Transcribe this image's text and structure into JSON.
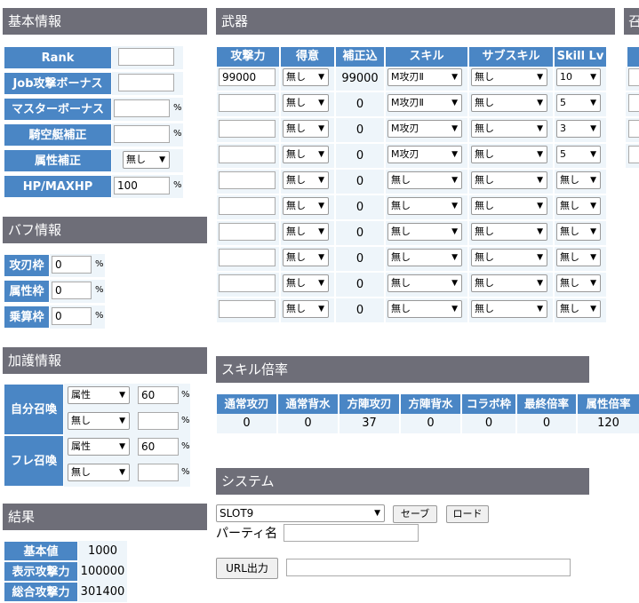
{
  "basic": {
    "title": "基本情報",
    "rank": "Rank",
    "job": "Job攻撃ボーナス",
    "master": "マスターボーナス",
    "sky": "騎空艇補正",
    "attr": "属性補正",
    "attr_value": "無し",
    "hp": "HP/MAXHP",
    "hp_value": "100",
    "pct": "%"
  },
  "buff": {
    "title": "バフ情報",
    "rows": [
      {
        "label": "攻刃枠",
        "value": "0"
      },
      {
        "label": "属性枠",
        "value": "0"
      },
      {
        "label": "乗算枠",
        "value": "0"
      }
    ]
  },
  "blessing": {
    "title": "加護情報",
    "self": "自分召喚",
    "friend": "フレ召喚",
    "self_rows": [
      {
        "type": "属性",
        "value": "60"
      },
      {
        "type": "無し",
        "value": ""
      }
    ],
    "friend_rows": [
      {
        "type": "属性",
        "value": "60"
      },
      {
        "type": "無し",
        "value": ""
      }
    ]
  },
  "result": {
    "title": "結果",
    "rows": [
      {
        "label": "基本値",
        "value": "1000"
      },
      {
        "label": "表示攻撃力",
        "value": "100000"
      },
      {
        "label": "総合攻撃力",
        "value": "301400"
      }
    ]
  },
  "weapon": {
    "title": "武器",
    "headers": [
      "攻撃力",
      "得意",
      "補正込",
      "スキル",
      "サブスキル",
      "Skill Lv"
    ],
    "rows": [
      {
        "atk": "99000",
        "fav": "無し",
        "corr": "99000",
        "skill": "M攻刃Ⅱ",
        "sub": "無し",
        "lv": "10"
      },
      {
        "atk": "",
        "fav": "無し",
        "corr": "0",
        "skill": "M攻刃Ⅱ",
        "sub": "無し",
        "lv": "5"
      },
      {
        "atk": "",
        "fav": "無し",
        "corr": "0",
        "skill": "M攻刃",
        "sub": "無し",
        "lv": "3"
      },
      {
        "atk": "",
        "fav": "無し",
        "corr": "0",
        "skill": "M攻刃",
        "sub": "無し",
        "lv": "5"
      },
      {
        "atk": "",
        "fav": "無し",
        "corr": "0",
        "skill": "無し",
        "sub": "無し",
        "lv": "無し"
      },
      {
        "atk": "",
        "fav": "無し",
        "corr": "0",
        "skill": "無し",
        "sub": "無し",
        "lv": "無し"
      },
      {
        "atk": "",
        "fav": "無し",
        "corr": "0",
        "skill": "無し",
        "sub": "無し",
        "lv": "無し"
      },
      {
        "atk": "",
        "fav": "無し",
        "corr": "0",
        "skill": "無し",
        "sub": "無し",
        "lv": "無し"
      },
      {
        "atk": "",
        "fav": "無し",
        "corr": "0",
        "skill": "無し",
        "sub": "無し",
        "lv": "無し"
      },
      {
        "atk": "",
        "fav": "無し",
        "corr": "0",
        "skill": "無し",
        "sub": "無し",
        "lv": "無し"
      }
    ]
  },
  "next": {
    "title": "召"
  },
  "skill_rate": {
    "title": "スキル倍率",
    "headers": [
      "通常攻刃",
      "通常背水",
      "方陣攻刃",
      "方陣背水",
      "コラボ枠",
      "最終倍率",
      "属性倍率"
    ],
    "values": [
      "0",
      "0",
      "37",
      "0",
      "0",
      "0",
      "120"
    ]
  },
  "system": {
    "title": "システム",
    "slot": "SLOT9",
    "save": "セーブ",
    "load": "ロード",
    "party_label": "パーティ名",
    "party_value": "",
    "url_button": "URL出力",
    "url_value": ""
  }
}
